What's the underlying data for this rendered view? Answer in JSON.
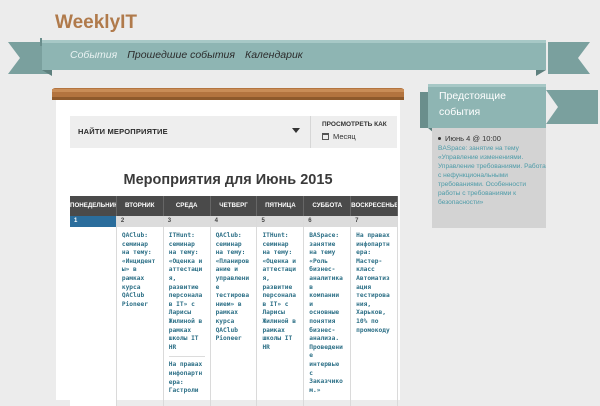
{
  "site": {
    "title": "WeeklyIT"
  },
  "nav": {
    "items": [
      {
        "label": "События"
      },
      {
        "label": "Прошедшие события"
      },
      {
        "label": "Календарик"
      }
    ]
  },
  "filter": {
    "find_label": "НАЙТИ МЕРОПРИЯТИЕ",
    "view_label": "ПРОСМОТРЕТЬ КАК",
    "view_value": "Месяц"
  },
  "calendar": {
    "title": "Мероприятия для Июнь 2015",
    "weekdays": [
      "ПОНЕДЕЛЬНИК",
      "ВТОРНИК",
      "СРЕДА",
      "ЧЕТВЕРГ",
      "ПЯТНИЦА",
      "СУББОТА",
      "ВОСКРЕСЕНЬЕ"
    ],
    "days": [
      {
        "num": "1",
        "events": []
      },
      {
        "num": "2",
        "events": [
          "QAClub: семинар на тему: «Инциденты» в рамках курса QAClub Pioneer"
        ]
      },
      {
        "num": "3",
        "events": [
          "ITHunt: семинар на тему: «Оценка и аттестация, развитие персонала в IT» с Ларисы Жилиной в рамках школы IT HR",
          "На правах инфопартнера: Гастроли"
        ]
      },
      {
        "num": "4",
        "events": [
          "QAClub: семинар на тему: «Планирование и управление тестированием» в рамках курса QAClub Pioneer"
        ]
      },
      {
        "num": "5",
        "events": [
          "ITHunt: семинар на тему: «Оценка и аттестация, развитие персонала в IT» с Ларисы Жилиной в рамках школы IT HR"
        ]
      },
      {
        "num": "6",
        "events": [
          "BASpace: занятие на тему «Роль бизнес-аналитика в компании и основные понятия бизнес-анализа. Проведение интервью с Заказчиком.»"
        ]
      },
      {
        "num": "7",
        "events": [
          "На правах инфопартнера: Мастер-класс Автоматизация тестирования, Харьков, 10% по промокоду"
        ]
      }
    ]
  },
  "sidebar": {
    "title": "Предстоящие события",
    "date": "Июнь 4 @ 10:00",
    "event_text": "BASpace: занятие на тему «Управление изменениями. Управление требованиями. Работа с нефункциональными требованиями. Особенности работы с требованиями к безопасности»"
  },
  "colors": {
    "ribbon": "#8eb5b3",
    "brand": "#b07a4b",
    "today": "#2a6d9c",
    "link": "#2c6f86"
  }
}
